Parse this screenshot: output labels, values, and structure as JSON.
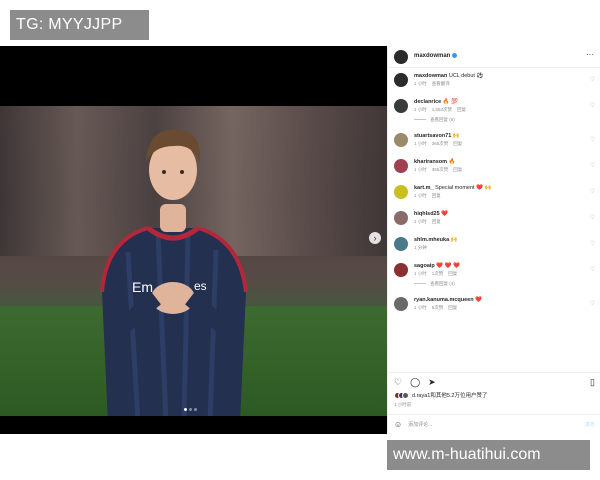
{
  "watermark": {
    "top": "TG: MYYJJPP",
    "bottom": "www.m-huatihui.com"
  },
  "post": {
    "username": "maxdowman",
    "more_icon": "···",
    "forward_icon": "›"
  },
  "comments": [
    {
      "user": "maxdowman",
      "text": "UCL debut ⚽",
      "time": "1 小时",
      "reply": "查看翻译",
      "likes": "",
      "avatar_color": "#2b2b2b"
    },
    {
      "user": "declanrice",
      "text": "🔥 💯",
      "time": "1 小时",
      "reply": "回复",
      "likes": "1,553次赞",
      "replies": "查看回复 (6)",
      "avatar_color": "#3a3a3a"
    },
    {
      "user": "stuartsavon71",
      "text": "🙌",
      "time": "1 小时",
      "reply": "回复",
      "likes": "366次赞",
      "avatar_color": "#9a8a6a"
    },
    {
      "user": "khariransom",
      "text": "🔥",
      "time": "1 小时",
      "reply": "回复",
      "likes": "365次赞",
      "avatar_color": "#a04050"
    },
    {
      "user": "kart.m_",
      "text": "Special moment ❤️ 🙌",
      "time": "1 小时",
      "reply": "回复",
      "likes": "",
      "avatar_color": "#c8c020"
    },
    {
      "user": "hiqhlsd25",
      "text": "❤️",
      "time": "1 小时",
      "reply": "回复",
      "likes": "",
      "avatar_color": "#8a6a6a"
    },
    {
      "user": "shlm.mheuka",
      "text": "🙌",
      "time": "1 分钟",
      "reply": "",
      "likes": "",
      "avatar_color": "#4a7a8a"
    },
    {
      "user": "sagoaip",
      "text": "❤️ ❤️ ❤️",
      "time": "1 小时",
      "reply": "回复",
      "likes": "1次赞",
      "replies": "查看回复 (4)",
      "avatar_color": "#8a3030"
    },
    {
      "user": "ryan.kanuma.mcqueen",
      "text": "❤️",
      "time": "1 小时",
      "reply": "回复",
      "likes": "6次赞",
      "avatar_color": "#6a6a6a"
    }
  ],
  "actions": {
    "like_icon": "♡",
    "comment_icon": "◯",
    "share_icon": "➤",
    "save_icon": "▯"
  },
  "likes_text": "d.raya1和其他5.2万位用户赞了",
  "time_ago": "1 小时前",
  "add_comment": {
    "emoji_icon": "☺",
    "placeholder": "添加评论...",
    "post_label": "发布"
  }
}
